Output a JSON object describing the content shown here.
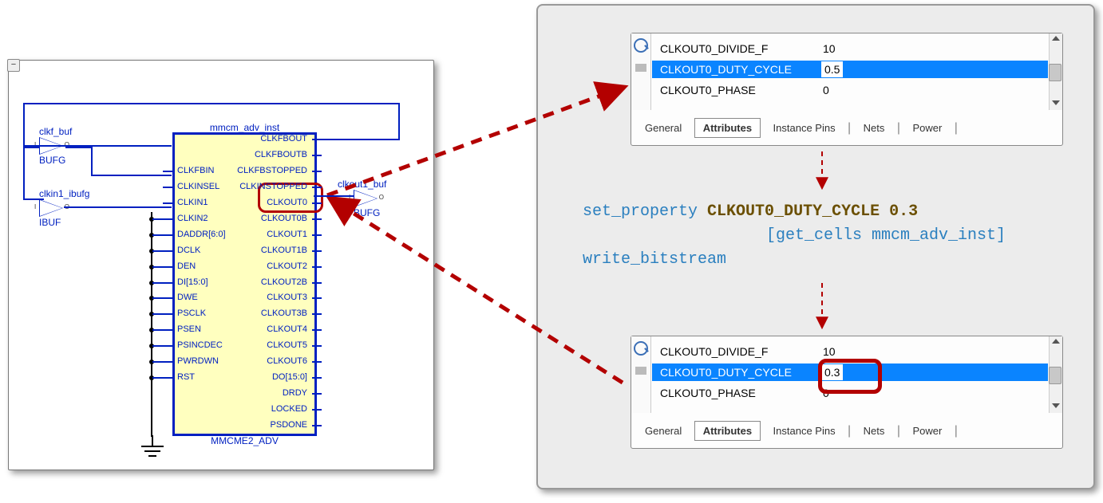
{
  "schematic": {
    "title": "mmcm_adv_inst",
    "block_type": "MMCME2_ADV",
    "bufs": {
      "clkf": {
        "label": "clkf_buf",
        "type": "BUFG"
      },
      "clkin1": {
        "label": "clkin1_ibufg",
        "type": "IBUF"
      },
      "clkout1": {
        "label": "clkout1_buf",
        "type": "BUFG"
      }
    },
    "left_pins": [
      "CLKFBIN",
      "CLKINSEL",
      "CLKIN1",
      "CLKIN2",
      "DADDR[6:0]",
      "DCLK",
      "DEN",
      "DI[15:0]",
      "DWE",
      "PSCLK",
      "PSEN",
      "PSINCDEC",
      "PWRDWN",
      "RST"
    ],
    "right_pins": [
      "CLKFBOUT",
      "CLKFBOUTB",
      "CLKFBSTOPPED",
      "CLKINSTOPPED",
      "CLKOUT0",
      "CLKOUT0B",
      "CLKOUT1",
      "CLKOUT1B",
      "CLKOUT2",
      "CLKOUT2B",
      "CLKOUT3",
      "CLKOUT3B",
      "CLKOUT4",
      "CLKOUT5",
      "CLKOUT6",
      "DO[15:0]",
      "DRDY",
      "LOCKED",
      "PSDONE"
    ]
  },
  "code": {
    "line1_cmd": "set_property",
    "line1_prop": "CLKOUT0_DUTY_CYCLE",
    "line1_val": "0.3",
    "line2_indent": "                     ",
    "line2": "[get_cells mmcm_adv_inst]",
    "line3": "write_bitstream"
  },
  "props": {
    "rows": [
      {
        "name": "CLKOUT0_DIVIDE_F",
        "value": "10"
      },
      {
        "name": "CLKOUT0_DUTY_CYCLE",
        "value_before": "0.5",
        "value_after": "0.3"
      },
      {
        "name": "CLKOUT0_PHASE",
        "value": "0"
      }
    ],
    "tabs": [
      "General",
      "Attributes",
      "Instance Pins",
      "Nets",
      "Power"
    ],
    "active_tab": "Attributes"
  },
  "minus": "−"
}
